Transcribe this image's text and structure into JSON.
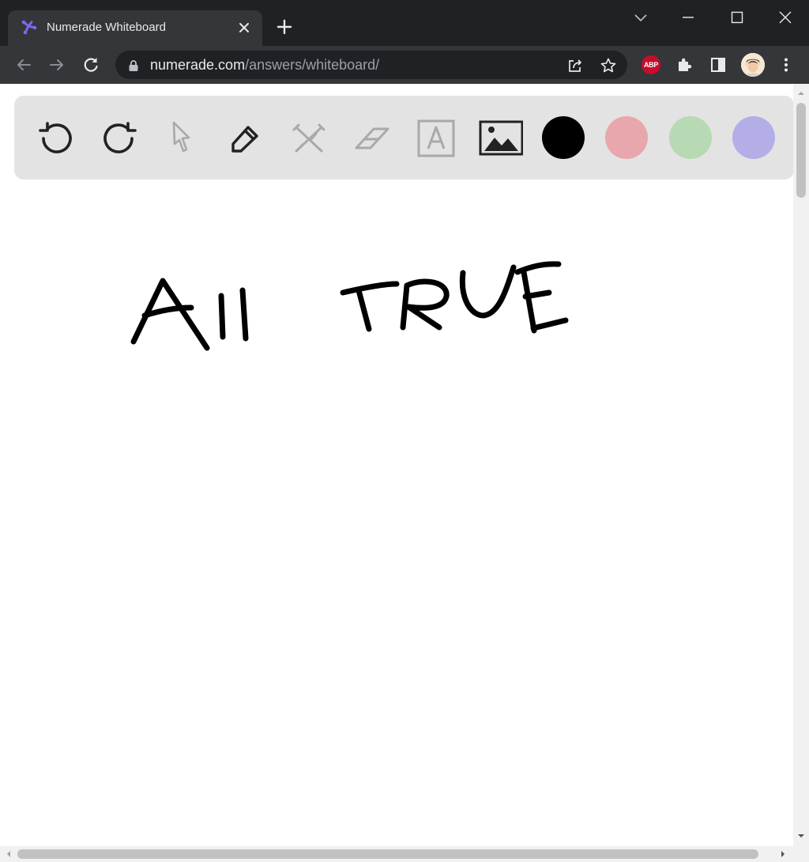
{
  "browser": {
    "tab_title": "Numerade Whiteboard",
    "url_host": "numerade.com",
    "url_path": "/answers/whiteboard/",
    "extension_abp_label": "ABP"
  },
  "whiteboard": {
    "tools": [
      "undo",
      "redo",
      "select",
      "pen",
      "shapes",
      "eraser",
      "text",
      "image"
    ],
    "disabled_tools": [
      "select",
      "shapes",
      "eraser",
      "text"
    ],
    "colors": [
      "#000000",
      "#e8a7ac",
      "#b7d9b4",
      "#b3aee6"
    ],
    "selected_color": "#000000",
    "handwritten_text": "All TRUE"
  }
}
